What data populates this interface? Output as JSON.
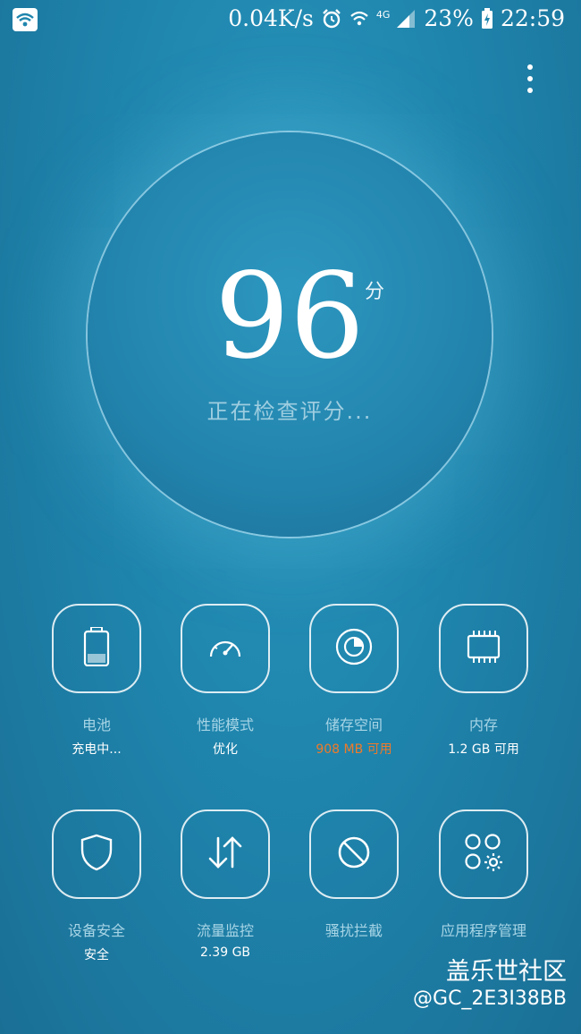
{
  "status_bar": {
    "speed": "0.04K/s",
    "network": "4G",
    "battery": "23%",
    "time": "22:59",
    "icons": [
      "wifi-icon",
      "alarm-icon",
      "wifi-signal-icon",
      "cellular-signal-icon",
      "battery-charging-icon"
    ]
  },
  "score": {
    "value": "96",
    "unit": "分",
    "status": "正在检查评分..."
  },
  "tiles": [
    {
      "label": "电池",
      "sub": "充电中...",
      "icon": "battery-icon"
    },
    {
      "label": "性能模式",
      "sub": "优化",
      "icon": "speedometer-icon"
    },
    {
      "label": "储存空间",
      "sub": "908 MB 可用",
      "icon": "storage-disc-icon",
      "sub_color": "#f07a28"
    },
    {
      "label": "内存",
      "sub": "1.2 GB 可用",
      "icon": "memory-chip-icon"
    },
    {
      "label": "设备安全",
      "sub": "安全",
      "icon": "shield-icon"
    },
    {
      "label": "流量监控",
      "sub": "2.39 GB",
      "icon": "data-transfer-icon"
    },
    {
      "label": "骚扰拦截",
      "sub": "",
      "icon": "block-icon"
    },
    {
      "label": "应用程序管理",
      "sub": "",
      "icon": "app-gear-icon"
    }
  ],
  "watermark": {
    "title": "盖乐世社区",
    "user": "@GC_2E3I38BB"
  },
  "colors": {
    "background": "#1f85ad",
    "accent_orange": "#f07a28"
  }
}
